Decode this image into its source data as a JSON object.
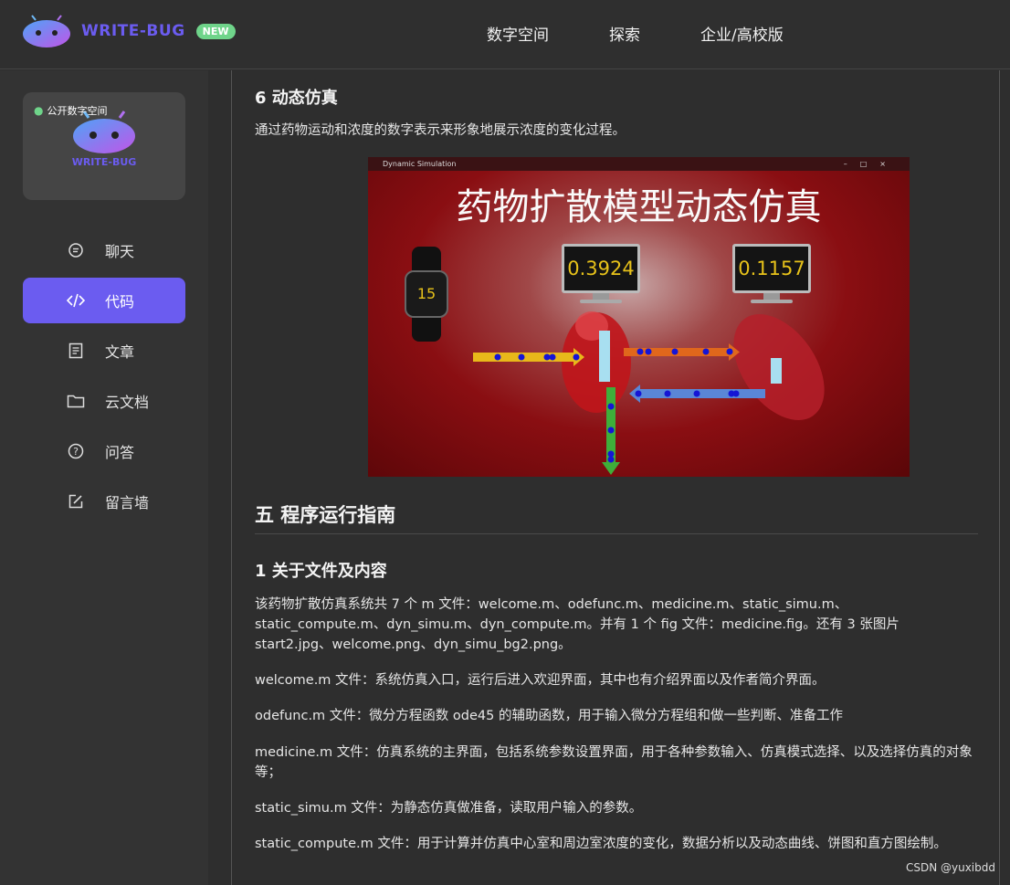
{
  "header": {
    "logo_text": "WRITE-BUG",
    "new_badge": "NEW",
    "nav": [
      "数字空间",
      "探索",
      "企业/高校版"
    ]
  },
  "sidebar": {
    "space_tag": "公开数字空间",
    "space_title": "WRITE-BUG",
    "items": [
      {
        "label": "聊天",
        "icon": "chat-icon"
      },
      {
        "label": "代码",
        "icon": "code-icon",
        "active": true
      },
      {
        "label": "文章",
        "icon": "article-icon"
      },
      {
        "label": "云文档",
        "icon": "folder-icon"
      },
      {
        "label": "问答",
        "icon": "question-icon"
      },
      {
        "label": "留言墙",
        "icon": "edit-icon"
      }
    ]
  },
  "article": {
    "s6_heading": "6 动态仿真",
    "s6_text": "通过药物运动和浓度的数字表示来形象地展示浓度的变化过程。",
    "figure": {
      "window_title": "Dynamic Simulation",
      "title": "药物扩散模型动态仿真",
      "watch_value": "15",
      "monitor1_value": "0.3924",
      "monitor2_value": "0.1157"
    },
    "ch5_heading": "五 程序运行指南",
    "s1_heading": "1 关于文件及内容",
    "paragraphs": [
      "该药物扩散仿真系统共 7 个 m 文件：welcome.m、odefunc.m、medicine.m、static_simu.m、static_compute.m、dyn_simu.m、dyn_compute.m。并有 1 个 fig 文件：medicine.fig。还有 3 张图片 start2.jpg、welcome.png、dyn_simu_bg2.png。",
      "welcome.m 文件：系统仿真入口，运行后进入欢迎界面，其中也有介绍界面以及作者简介界面。",
      "odefunc.m 文件：微分方程函数 ode45 的辅助函数，用于输入微分方程组和做一些判断、准备工作",
      "medicine.m 文件：仿真系统的主界面，包括系统参数设置界面，用于各种参数输入、仿真模式选择、以及选择仿真的对象等；",
      "static_simu.m 文件：为静态仿真做准备，读取用户输入的参数。",
      "static_compute.m 文件：用于计算并仿真中心室和周边室浓度的变化，数据分析以及动态曲线、饼图和直方图绘制。"
    ]
  },
  "watermark": "CSDN @yuxibdd"
}
